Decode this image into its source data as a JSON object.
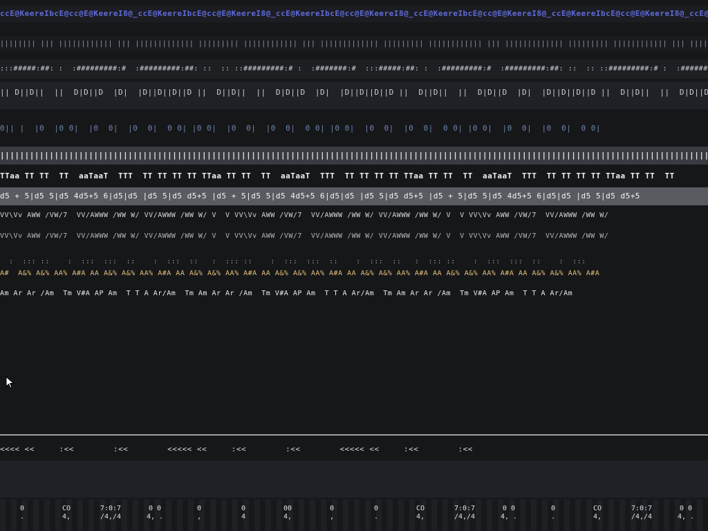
{
  "rows": {
    "links": "ccE@KeereIbcE@cc@E@KeereI8@_ccE@KeereIbcE@cc@E@KeereI8@_ccE@KeereIbcE@cc@E@KeereI8@_ccE@KeereIbcE@cc@E@KeereI8@_ccE@KeereIbcE@cc@E@KeereI8@_ccE@KeereIbcE@cc@E@KeereI8@_",
    "menu": "|||||||| ||| |||||||||||| ||| ||||||||||||| ||||||||| |||||||||||| ||| ||||||||||||| ||||||||| |||||||||||| ||| ||||||||||||| ||||||||| |||||||||||| ||| |||||",
    "tools": ":::#####:##: :  :#########:#  :#########:##: ::  :: ::#########:# :  :#######:#  :::#####:##: :  :#########:#  :#########:##: ::  :: ::#########:# :  :#######:#",
    "tabs": "|| D||D||  ||  D|D||D  |D|  |D||D||D||D ||  D||D||  ||  D|D||D  |D|  |D||D||D||D ||  D||D||  ||  D|D||D  |D|  |D||D||D||D ||  D||D||  ||  D|D||D  |D|  |D",
    "status": "0|| |  |0  |0 0|  |0  0|  |0  0|  0 0| |0 0|  |0  0|  |0  0|  0 0| |0 0|  |0  0|  |0  0|  0 0| |0 0|  |0  0|  |0  0|  0 0|",
    "ruler": "||||||||||||||||||||||||||||||||||||||||||||||||||||||||||||||||||||||||||||||||||||||||||||||||||||||||||||||||||||||||||||||||||||||||||||||||||||||||||",
    "headers": "TTaa TT TT  TT  aaTaaT  TTT  TT TT TT TT TTaa TT TT  TT  aaTaaT  TTT  TT TT TT TT TTaa TT TT  TT  aaTaaT  TTT  TT TT TT TT TTaa TT TT  TT",
    "values": "d5 + 5|d5 5|d5 4d5+5 6|d5|d5 |d5 5|d5 d5+5 |d5 + 5|d5 5|d5 4d5+5 6|d5|d5 |d5 5|d5 d5+5 |d5 + 5|d5 5|d5 4d5+5 6|d5|d5 |d5 5|d5 d5+5",
    "wave1": "VV\\Vv AWW /VW/7  VV/AWWW /WW W/ VV/AWWW /WW W/ V  V VV\\Vv AWW /VW/7  VV/AWWW /WW W/ VV/AWWW /WW W/ V  V VV\\Vv AWW /VW/7  VV/AWWW /WW W/",
    "wave2": "VV\\Vv AWW /VW/7  VV/AWWW /WW W/ VV/AWWW /WW W/ V  V VV\\Vv AWW /VW/7  VV/AWWW /WW W/ VV/AWWW /WW W/ V  V VV\\Vv AWW /VW/7  VV/AWWW /WW W/",
    "index": "  :  ::: ::    :  :::  :::  ::    :  :::  ::   :  ::: ::    :  :::  :::  ::    :  :::  ::   :  ::: ::    :  :::  :::  ::    :  :::",
    "annot1": "A#  A&% A&% AA% A#A AA A&% A&% AA% A#A AA A&% A&% AA% A#A AA A&% A&% AA% A#A AA A&% A&% AA% A#A AA A&% A&% AA% A#A AA A&% A&% AA% A#A",
    "annot2": "Am Ar Ar /Am  Tm V#A AP Am  T T A Ar/Am  Tm Am Ar Ar /Am  Tm V#A AP Am  T T A Ar/Am  Tm Am Ar Ar /Am  Tm V#A AP Am  T T A Ar/Am",
    "nav": "<<<< <<     :<<        :<<        <<<<< <<     :<<        :<<        <<<<< <<     :<<        :<<"
  },
  "footer": {
    "cells": [
      {
        "a": "0",
        "b": "."
      },
      {
        "a": "CO",
        "b": "4,"
      },
      {
        "a": "7:0:7",
        "b": "/4,/4"
      },
      {
        "a": "0 0",
        "b": "4, ."
      },
      {
        "a": "0",
        "b": ","
      },
      {
        "a": "0",
        "b": "4"
      },
      {
        "a": "00",
        "b": "4,"
      },
      {
        "a": "0",
        "b": ","
      },
      {
        "a": "0",
        "b": "."
      },
      {
        "a": "CO",
        "b": "4,"
      },
      {
        "a": "7:0:7",
        "b": "/4,/4"
      },
      {
        "a": "0 0",
        "b": "4, ."
      },
      {
        "a": "0",
        "b": "."
      },
      {
        "a": "CO",
        "b": "4,"
      },
      {
        "a": "7:0:7",
        "b": "/4,/4"
      },
      {
        "a": "0 0",
        "b": "4, ."
      }
    ]
  },
  "icons": {
    "cursor": "mouse-pointer-icon"
  },
  "colors": {
    "background": "#161719",
    "link": "#5f6bd8",
    "ruler": "#3a3b40",
    "values_bar": "#5a5b60",
    "annotation": "#e4c17a",
    "divider": "#9e9ea4"
  }
}
